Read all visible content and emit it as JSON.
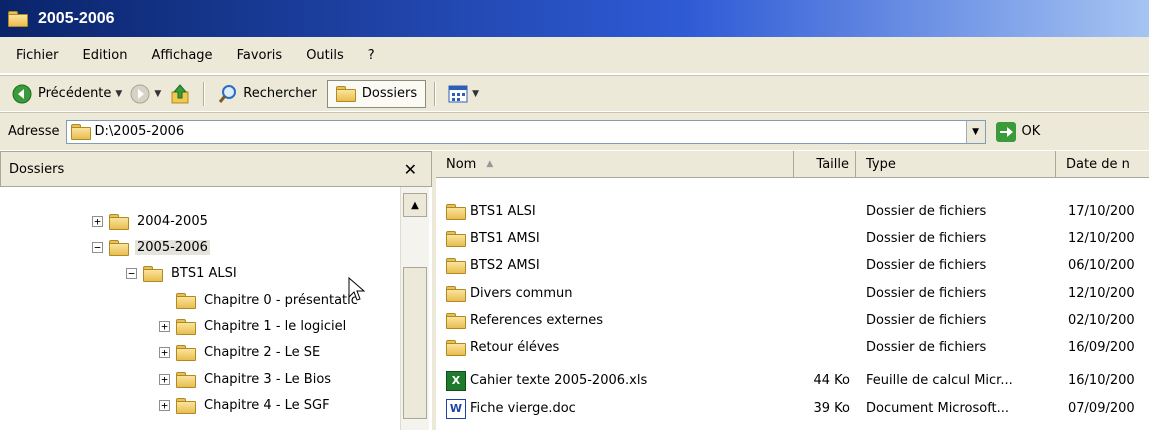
{
  "window": {
    "title": "2005-2006"
  },
  "menu": [
    "Fichier",
    "Edition",
    "Affichage",
    "Favoris",
    "Outils",
    "?"
  ],
  "toolbar": {
    "back": "Précédente",
    "search": "Rechercher",
    "folders": "Dossiers"
  },
  "address": {
    "label": "Adresse",
    "value": "D:\\2005-2006",
    "go": "OK"
  },
  "folders_pane": {
    "title": "Dossiers",
    "nodes": [
      {
        "label": "2004-2005",
        "expander": "+"
      },
      {
        "label": "2005-2006",
        "expander": "−"
      },
      {
        "label": "BTS1 ALSI",
        "expander": "−"
      },
      {
        "label": "Chapitre 0 - présentatic",
        "expander": ""
      },
      {
        "label": "Chapitre 1 - le logiciel",
        "expander": "+"
      },
      {
        "label": "Chapitre 2 - Le SE",
        "expander": "+"
      },
      {
        "label": "Chapitre 3 - Le Bios",
        "expander": "+"
      },
      {
        "label": "Chapitre 4 - Le SGF",
        "expander": "+"
      }
    ]
  },
  "file_list": {
    "columns": {
      "name": "Nom",
      "size": "Taille",
      "type": "Type",
      "date": "Date de n"
    },
    "rows": [
      {
        "icon": "folder-icon",
        "name": "BTS1 ALSI",
        "size": "",
        "type": "Dossier de fichiers",
        "date": "17/10/200"
      },
      {
        "icon": "folder-icon",
        "name": "BTS1 AMSI",
        "size": "",
        "type": "Dossier de fichiers",
        "date": "12/10/200"
      },
      {
        "icon": "folder-icon",
        "name": "BTS2 AMSI",
        "size": "",
        "type": "Dossier de fichiers",
        "date": "06/10/200"
      },
      {
        "icon": "folder-icon",
        "name": "Divers commun",
        "size": "",
        "type": "Dossier de fichiers",
        "date": "12/10/200"
      },
      {
        "icon": "folder-icon",
        "name": "References externes",
        "size": "",
        "type": "Dossier de fichiers",
        "date": "02/10/200"
      },
      {
        "icon": "folder-icon",
        "name": "Retour éléves",
        "size": "",
        "type": "Dossier de fichiers",
        "date": "16/09/200"
      },
      {
        "icon": "excel-icon",
        "name": "Cahier texte 2005-2006.xls",
        "size": "44 Ko",
        "type": "Feuille de calcul Micr...",
        "date": "16/10/200"
      },
      {
        "icon": "word-icon",
        "name": "Fiche vierge.doc",
        "size": "39 Ko",
        "type": "Document Microsoft...",
        "date": "07/09/200"
      }
    ]
  }
}
